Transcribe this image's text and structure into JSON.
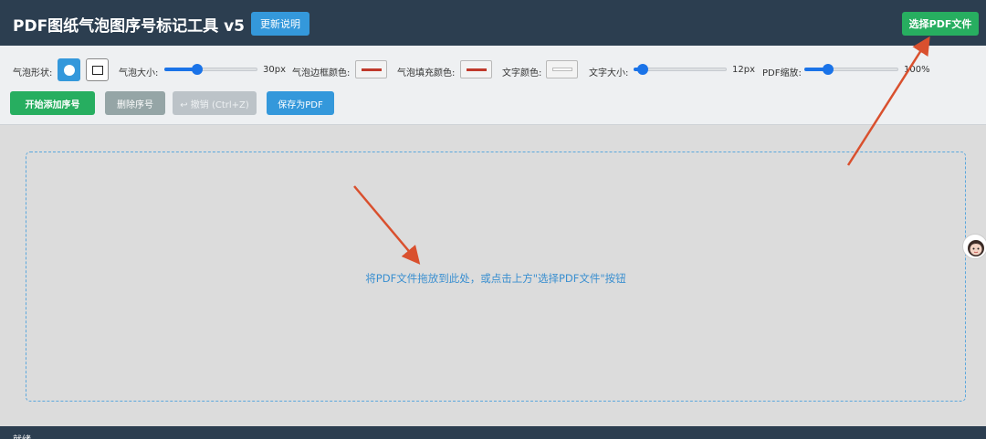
{
  "header": {
    "title": "PDF图纸气泡图序号标记工具 v5",
    "update_label": "更新说明",
    "select_pdf_label": "选择PDF文件"
  },
  "toolbar": {
    "shape_label": "气泡形状:",
    "size_label": "气泡大小:",
    "size_value": "30px",
    "border_color_label": "气泡边框颜色:",
    "fill_color_label": "气泡填充颜色:",
    "text_color_label": "文字颜色:",
    "font_size_label": "文字大小:",
    "font_size_value": "12px",
    "zoom_label": "PDF缩放:",
    "zoom_value": "100%",
    "bubble_size_fraction": 0.35,
    "font_size_fraction": 0.1,
    "zoom_fraction": 0.25
  },
  "colors": {
    "border_color": "#c0392b",
    "fill_color": "#c0392b",
    "text_color": "#ffffff",
    "header_bg": "#2c3e50",
    "accent_blue": "#3498db",
    "accent_green": "#27ae60"
  },
  "actions": {
    "start_label": "开始添加序号",
    "delete_label": "删除序号",
    "undo_label": "↩ 撤销 (Ctrl+Z)",
    "save_label": "保存为PDF"
  },
  "dropzone": {
    "text": "将PDF文件拖放到此处，或点击上方\"选择PDF文件\"按钮"
  },
  "status": {
    "text": "就绪"
  }
}
